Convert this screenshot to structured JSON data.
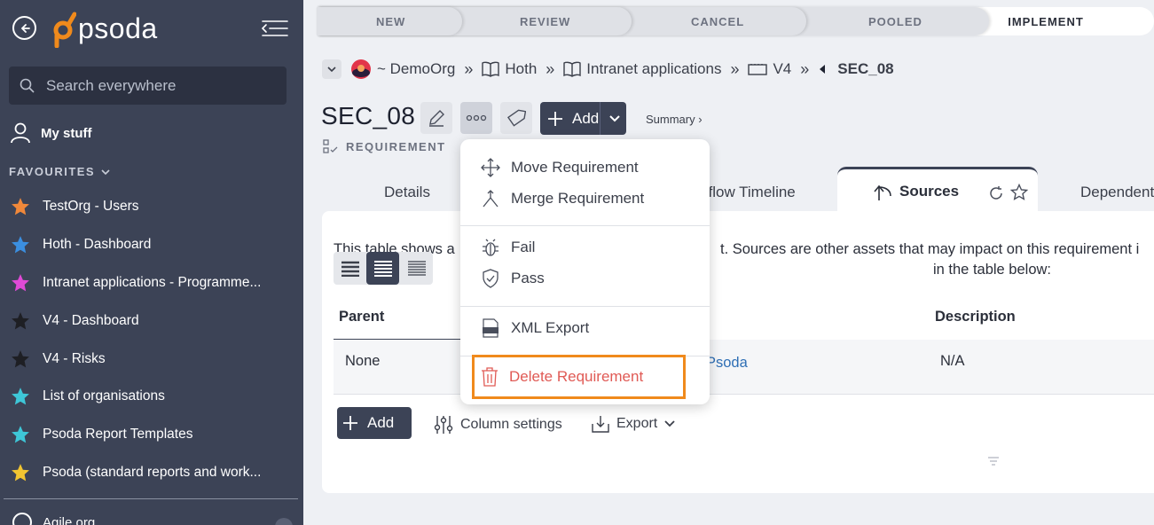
{
  "sidebar": {
    "logo_text": "psoda",
    "search_placeholder": "Search everywhere",
    "my_stuff": "My stuff",
    "favourites_heading": "FAVOURITES",
    "favourites": [
      {
        "label": "TestOrg - Users",
        "star_color": "#f0883a"
      },
      {
        "label": "Hoth - Dashboard",
        "star_color": "#3b8fe0"
      },
      {
        "label": "Intranet applications - Programme...",
        "star_color": "#e04ad6"
      },
      {
        "label": "V4 - Dashboard",
        "star_color": "#1e1f24"
      },
      {
        "label": "V4 - Risks",
        "star_color": "#1e1f24"
      },
      {
        "label": "List of organisations",
        "star_color": "#3ec7d8"
      },
      {
        "label": "Psoda Report Templates",
        "star_color": "#3ec7d8"
      },
      {
        "label": "Psoda (standard reports and work...",
        "star_color": "#f2c531"
      }
    ],
    "bottom_item": "Agile org"
  },
  "stages": [
    "NEW",
    "REVIEW",
    "CANCEL",
    "POOLED",
    "IMPLEMENT"
  ],
  "breadcrumb": {
    "org": "~ DemoOrg",
    "items": [
      "Hoth",
      "Intranet applications",
      "V4"
    ],
    "current": "SEC_08"
  },
  "header": {
    "title": "SEC_08",
    "add_label": "Add",
    "summary_label": "Summary ›",
    "type_label": "REQUIREMENT"
  },
  "tabs": {
    "details": "Details",
    "workflow": "kflow Timeline",
    "sources": "Sources",
    "dependents": "Dependent"
  },
  "content": {
    "description_part1": "This table shows a",
    "description_part2": "t. Sources are other assets that may impact on this requirement i",
    "description_line2": "in the table below:",
    "columns": {
      "parent": "Parent",
      "description": "Description"
    },
    "row": {
      "parent": "None",
      "link": "Psoda",
      "description": "N/A"
    },
    "add_label": "Add",
    "column_settings": "Column settings",
    "export": "Export"
  },
  "menu": {
    "move": "Move Requirement",
    "merge": "Merge Requirement",
    "fail": "Fail",
    "pass": "Pass",
    "xml_export": "XML Export",
    "delete": "Delete Requirement"
  },
  "colors": {
    "sidebar_bg": "#3c4356",
    "accent_orange": "#f08a1c",
    "danger": "#e05a55",
    "link": "#2f6fb5"
  }
}
